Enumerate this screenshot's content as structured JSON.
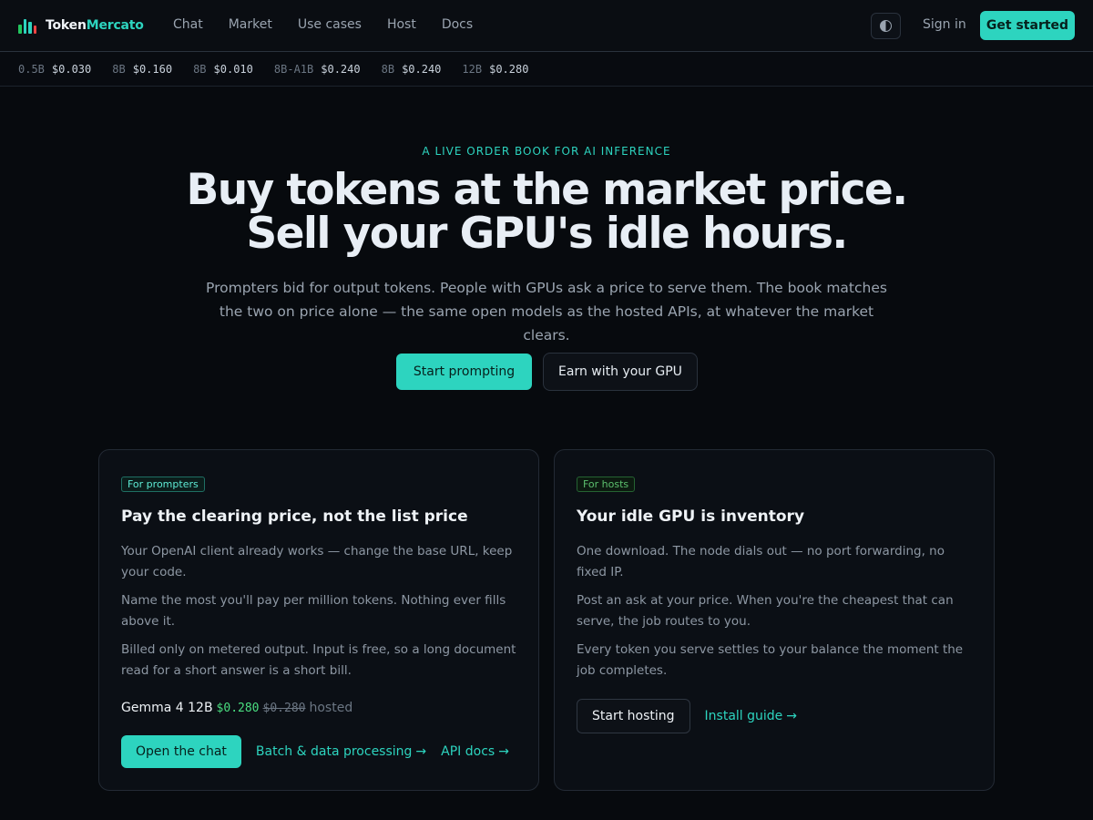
{
  "brand": {
    "name_part1": "Token",
    "name_part2": "Mercato",
    "icon": "bar-chart-icon",
    "bar_colors": [
      "#22c55e",
      "#2dd4bf",
      "#2dd4bf",
      "#ef4444"
    ],
    "accent": "#2dd4bf"
  },
  "nav": {
    "links": [
      "Chat",
      "Market",
      "Use cases",
      "Host",
      "Docs"
    ],
    "theme_icon": "contrast-icon",
    "signin": "Sign in",
    "get_started": "Get started"
  },
  "ticker": [
    {
      "size": "0.5B",
      "price": "$0.030"
    },
    {
      "size": "8B",
      "price": "$0.160"
    },
    {
      "size": "8B",
      "price": "$0.010"
    },
    {
      "size": "8B-A1B",
      "price": "$0.240"
    },
    {
      "size": "8B",
      "price": "$0.240"
    },
    {
      "size": "12B",
      "price": "$0.280"
    }
  ],
  "hero": {
    "eyebrow": "A LIVE ORDER BOOK FOR AI INFERENCE",
    "headline_line1": "Buy tokens at the market price.",
    "headline_line2": "Sell your GPU's idle hours.",
    "subhead": "Prompters bid for output tokens. People with GPUs ask a price to serve them. The book matches the two on price alone — the same open models as the hosted APIs, at whatever the market clears.",
    "cta_primary": "Start prompting",
    "cta_secondary": "Earn with your GPU"
  },
  "cards": {
    "prompters": {
      "badge": "For prompters",
      "title": "Pay the clearing price, not the list price",
      "paragraphs": [
        "Your OpenAI client already works — change the base URL, keep your code.",
        "Name the most you'll pay per million tokens. Nothing ever fills above it.",
        "Billed only on metered output. Input is free, so a long document read for a short answer is a short bill."
      ],
      "price_line": {
        "model": "Gemma 4 12B",
        "clearing_price": "$0.280",
        "list_price": "$0.280",
        "suffix": "hosted"
      },
      "primary_button": "Open the chat",
      "link1": "Batch & data processing",
      "link2": "API docs",
      "arrow": "→"
    },
    "hosts": {
      "badge": "For hosts",
      "title": "Your idle GPU is inventory",
      "paragraphs": [
        "One download. The node dials out — no port forwarding, no fixed IP.",
        "Post an ask at your price. When you're the cheapest that can serve, the job routes to you.",
        "Every token you serve settles to your balance the moment the job completes."
      ],
      "primary_button": "Start hosting",
      "link1": "Install guide",
      "arrow": "→"
    }
  }
}
